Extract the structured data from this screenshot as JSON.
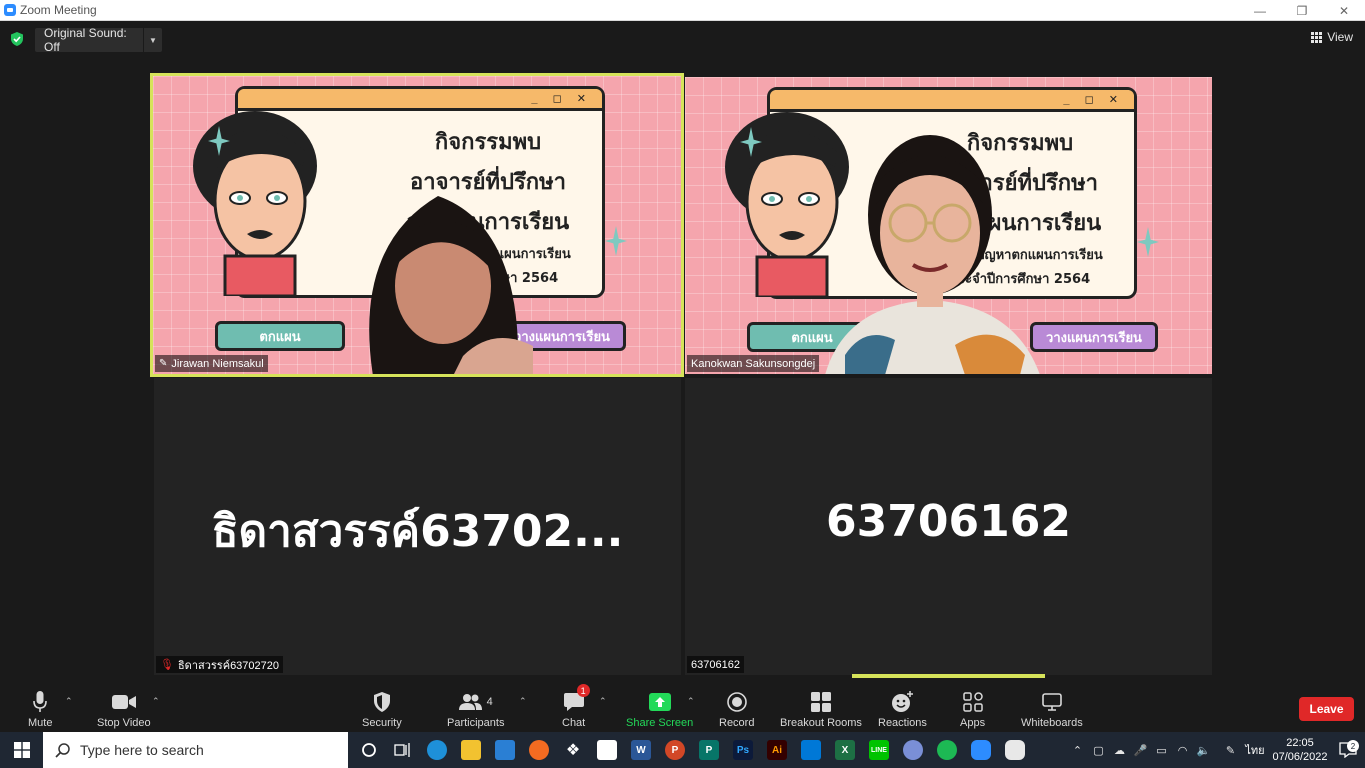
{
  "window": {
    "title": "Zoom Meeting",
    "controls": [
      "—",
      "❐",
      "✕"
    ]
  },
  "top_bar": {
    "original_sound": "Original Sound: Off",
    "view_label": "View"
  },
  "slide": {
    "title_line1": "กิจกรรมพบ",
    "title_line2": "อาจารย์ที่ปรึกษา",
    "title_line3": "วางแผนการเรียน",
    "subtitle_line1": "ปรึกษาปัญหาตกแผนการเรียน",
    "subtitle_line2": "ประจำปีการศึกษา 2564",
    "window_controls": "_ ◻ ✕",
    "button_left": "ตกแผน",
    "button_right": "วางแผนการเรียน"
  },
  "participants": [
    {
      "name": "Jirawan Niemsakul",
      "pinned": true,
      "active": true
    },
    {
      "name": "Kanokwan Sakunsongdej"
    },
    {
      "name": "ธิดาสวรรค์63702720",
      "display": "ธิดาสวรรค์63702...",
      "muted": true
    },
    {
      "name": "63706162",
      "display": "63706162"
    }
  ],
  "toolbar": {
    "mute": "Mute",
    "stop_video": "Stop Video",
    "security": "Security",
    "participants": "Participants",
    "participants_count": "4",
    "chat": "Chat",
    "chat_badge": "1",
    "share_screen": "Share Screen",
    "record": "Record",
    "breakout_rooms": "Breakout Rooms",
    "reactions": "Reactions",
    "apps": "Apps",
    "whiteboards": "Whiteboards",
    "leave": "Leave"
  },
  "taskbar": {
    "search_placeholder": "Type here to search",
    "time": "22:05",
    "date": "07/06/2022",
    "language": "ไทย",
    "notification_count": "2"
  },
  "colors": {
    "active_speaker": "#d6e35a",
    "leave": "#e02828",
    "share": "#23d959",
    "slide_bg": "#f5a5ad"
  }
}
